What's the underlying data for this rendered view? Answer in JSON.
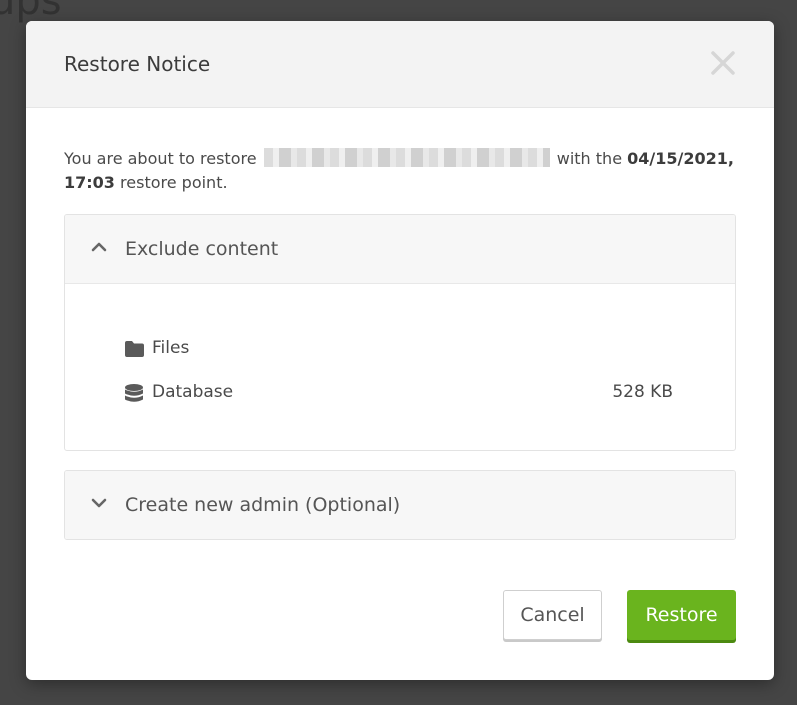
{
  "background": {
    "heading": "ups"
  },
  "modal": {
    "title": "Restore Notice",
    "intro_prefix": "You are about to restore",
    "intro_middle": "with the",
    "restore_point": "04/15/2021, 17:03",
    "intro_suffix": "restore point."
  },
  "exclude_panel": {
    "title": "Exclude content",
    "items": [
      {
        "label": "Files",
        "icon": "folder-icon",
        "size": ""
      },
      {
        "label": "Database",
        "icon": "database-icon",
        "size": "528 KB"
      }
    ]
  },
  "admin_panel": {
    "title": "Create new admin (Optional)"
  },
  "buttons": {
    "cancel": "Cancel",
    "restore": "Restore"
  },
  "colors": {
    "accent": "#6ab41e",
    "header_bg": "#f3f3f3"
  }
}
